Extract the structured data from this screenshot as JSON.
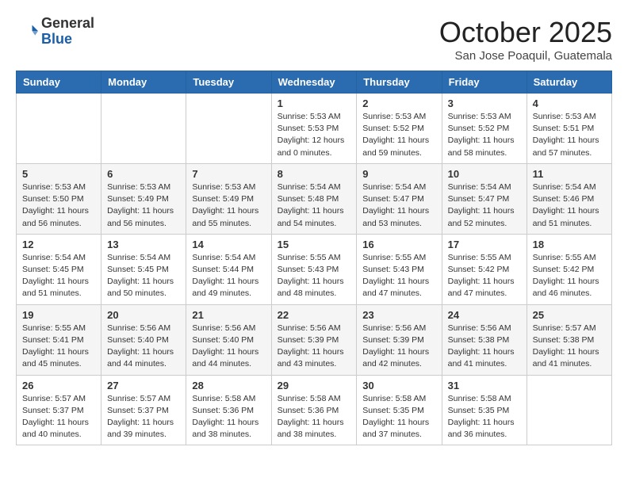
{
  "header": {
    "logo": {
      "general": "General",
      "blue": "Blue"
    },
    "title": "October 2025",
    "location": "San Jose Poaquil, Guatemala"
  },
  "weekdays": [
    "Sunday",
    "Monday",
    "Tuesday",
    "Wednesday",
    "Thursday",
    "Friday",
    "Saturday"
  ],
  "weeks": [
    [
      {
        "day": "",
        "info": ""
      },
      {
        "day": "",
        "info": ""
      },
      {
        "day": "",
        "info": ""
      },
      {
        "day": "1",
        "info": "Sunrise: 5:53 AM\nSunset: 5:53 PM\nDaylight: 12 hours and 0 minutes."
      },
      {
        "day": "2",
        "info": "Sunrise: 5:53 AM\nSunset: 5:52 PM\nDaylight: 11 hours and 59 minutes."
      },
      {
        "day": "3",
        "info": "Sunrise: 5:53 AM\nSunset: 5:52 PM\nDaylight: 11 hours and 58 minutes."
      },
      {
        "day": "4",
        "info": "Sunrise: 5:53 AM\nSunset: 5:51 PM\nDaylight: 11 hours and 57 minutes."
      }
    ],
    [
      {
        "day": "5",
        "info": "Sunrise: 5:53 AM\nSunset: 5:50 PM\nDaylight: 11 hours and 56 minutes."
      },
      {
        "day": "6",
        "info": "Sunrise: 5:53 AM\nSunset: 5:49 PM\nDaylight: 11 hours and 56 minutes."
      },
      {
        "day": "7",
        "info": "Sunrise: 5:53 AM\nSunset: 5:49 PM\nDaylight: 11 hours and 55 minutes."
      },
      {
        "day": "8",
        "info": "Sunrise: 5:54 AM\nSunset: 5:48 PM\nDaylight: 11 hours and 54 minutes."
      },
      {
        "day": "9",
        "info": "Sunrise: 5:54 AM\nSunset: 5:47 PM\nDaylight: 11 hours and 53 minutes."
      },
      {
        "day": "10",
        "info": "Sunrise: 5:54 AM\nSunset: 5:47 PM\nDaylight: 11 hours and 52 minutes."
      },
      {
        "day": "11",
        "info": "Sunrise: 5:54 AM\nSunset: 5:46 PM\nDaylight: 11 hours and 51 minutes."
      }
    ],
    [
      {
        "day": "12",
        "info": "Sunrise: 5:54 AM\nSunset: 5:45 PM\nDaylight: 11 hours and 51 minutes."
      },
      {
        "day": "13",
        "info": "Sunrise: 5:54 AM\nSunset: 5:45 PM\nDaylight: 11 hours and 50 minutes."
      },
      {
        "day": "14",
        "info": "Sunrise: 5:54 AM\nSunset: 5:44 PM\nDaylight: 11 hours and 49 minutes."
      },
      {
        "day": "15",
        "info": "Sunrise: 5:55 AM\nSunset: 5:43 PM\nDaylight: 11 hours and 48 minutes."
      },
      {
        "day": "16",
        "info": "Sunrise: 5:55 AM\nSunset: 5:43 PM\nDaylight: 11 hours and 47 minutes."
      },
      {
        "day": "17",
        "info": "Sunrise: 5:55 AM\nSunset: 5:42 PM\nDaylight: 11 hours and 47 minutes."
      },
      {
        "day": "18",
        "info": "Sunrise: 5:55 AM\nSunset: 5:42 PM\nDaylight: 11 hours and 46 minutes."
      }
    ],
    [
      {
        "day": "19",
        "info": "Sunrise: 5:55 AM\nSunset: 5:41 PM\nDaylight: 11 hours and 45 minutes."
      },
      {
        "day": "20",
        "info": "Sunrise: 5:56 AM\nSunset: 5:40 PM\nDaylight: 11 hours and 44 minutes."
      },
      {
        "day": "21",
        "info": "Sunrise: 5:56 AM\nSunset: 5:40 PM\nDaylight: 11 hours and 44 minutes."
      },
      {
        "day": "22",
        "info": "Sunrise: 5:56 AM\nSunset: 5:39 PM\nDaylight: 11 hours and 43 minutes."
      },
      {
        "day": "23",
        "info": "Sunrise: 5:56 AM\nSunset: 5:39 PM\nDaylight: 11 hours and 42 minutes."
      },
      {
        "day": "24",
        "info": "Sunrise: 5:56 AM\nSunset: 5:38 PM\nDaylight: 11 hours and 41 minutes."
      },
      {
        "day": "25",
        "info": "Sunrise: 5:57 AM\nSunset: 5:38 PM\nDaylight: 11 hours and 41 minutes."
      }
    ],
    [
      {
        "day": "26",
        "info": "Sunrise: 5:57 AM\nSunset: 5:37 PM\nDaylight: 11 hours and 40 minutes."
      },
      {
        "day": "27",
        "info": "Sunrise: 5:57 AM\nSunset: 5:37 PM\nDaylight: 11 hours and 39 minutes."
      },
      {
        "day": "28",
        "info": "Sunrise: 5:58 AM\nSunset: 5:36 PM\nDaylight: 11 hours and 38 minutes."
      },
      {
        "day": "29",
        "info": "Sunrise: 5:58 AM\nSunset: 5:36 PM\nDaylight: 11 hours and 38 minutes."
      },
      {
        "day": "30",
        "info": "Sunrise: 5:58 AM\nSunset: 5:35 PM\nDaylight: 11 hours and 37 minutes."
      },
      {
        "day": "31",
        "info": "Sunrise: 5:58 AM\nSunset: 5:35 PM\nDaylight: 11 hours and 36 minutes."
      },
      {
        "day": "",
        "info": ""
      }
    ]
  ]
}
